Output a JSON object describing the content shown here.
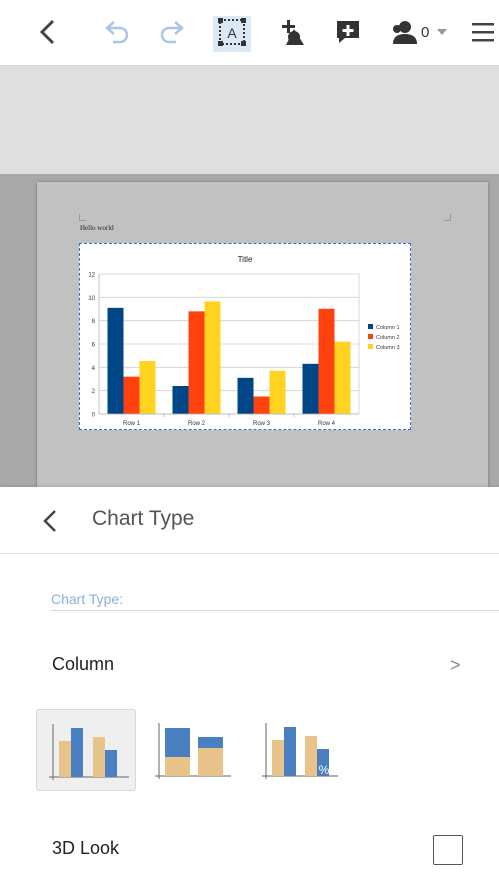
{
  "toolbar": {
    "users_count": "0"
  },
  "document": {
    "text": "Hello world"
  },
  "chart_data": {
    "type": "bar",
    "title": "Title",
    "categories": [
      "Row 1",
      "Row 2",
      "Row 3",
      "Row 4"
    ],
    "series": [
      {
        "name": "Column 1",
        "color": "#004586",
        "values": [
          9.1,
          2.4,
          3.1,
          4.3
        ]
      },
      {
        "name": "Column 2",
        "color": "#ff420e",
        "values": [
          3.2,
          8.8,
          1.5,
          9.02
        ]
      },
      {
        "name": "Column 3",
        "color": "#ffd320",
        "values": [
          4.54,
          9.65,
          3.7,
          6.2
        ]
      }
    ],
    "ylim": [
      0,
      12
    ],
    "yticks": [
      0,
      2,
      4,
      6,
      8,
      10,
      12
    ],
    "grid": true,
    "legend": "right"
  },
  "panel": {
    "title": "Chart Type",
    "section_label": "Chart Type:",
    "chart_type": "Column",
    "arrow": ">",
    "variants": [
      {
        "name": "normal",
        "selected": true
      },
      {
        "name": "stacked",
        "selected": false
      },
      {
        "name": "percent-stacked",
        "selected": false,
        "badge": "%"
      }
    ],
    "look_label": "3D Look",
    "look_checked": false
  },
  "colors": {
    "variant_blue": "#4a7fc1",
    "variant_tan": "#e8c48a",
    "accent": "#2b6fd1"
  }
}
